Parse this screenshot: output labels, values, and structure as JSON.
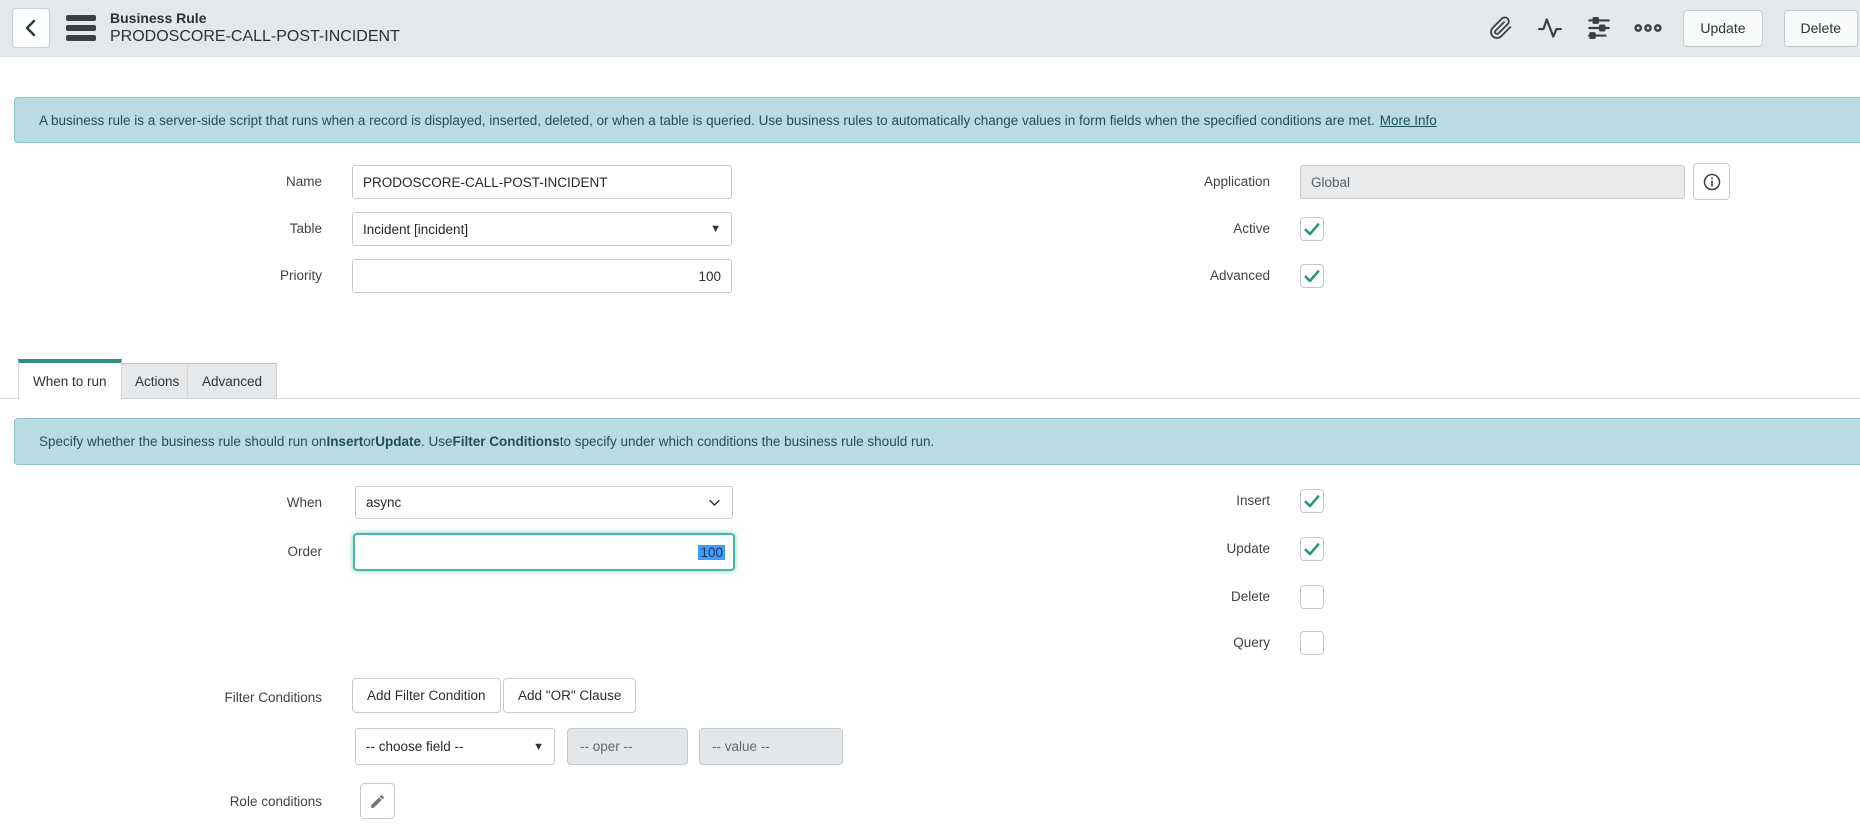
{
  "header": {
    "title": "Business Rule",
    "subtitle": "PRODOSCORE-CALL-POST-INCIDENT",
    "update_label": "Update",
    "delete_label": "Delete"
  },
  "banner_top": {
    "text": "A business rule is a server-side script that runs when a record is displayed, inserted, deleted, or when a table is queried. Use business rules to automatically change values in form fields when the specified conditions are met.",
    "link": "More Info"
  },
  "form": {
    "name": {
      "label": "Name",
      "value": "PRODOSCORE-CALL-POST-INCIDENT"
    },
    "table": {
      "label": "Table",
      "value": "Incident [incident]"
    },
    "priority": {
      "label": "Priority",
      "value": "100"
    },
    "application": {
      "label": "Application",
      "value": "Global"
    },
    "active": {
      "label": "Active",
      "checked": true
    },
    "advanced": {
      "label": "Advanced",
      "checked": true
    }
  },
  "tabs": [
    {
      "label": "When to run",
      "active": true
    },
    {
      "label": "Actions",
      "active": false
    },
    {
      "label": "Advanced",
      "active": false
    }
  ],
  "banner_when": {
    "segments": [
      "Specify whether the business rule should run on ",
      "Insert",
      " or ",
      "Update",
      ". Use ",
      "Filter Conditions",
      " to specify under which conditions the business rule should run."
    ]
  },
  "when_to_run": {
    "when": {
      "label": "When",
      "value": "async"
    },
    "order": {
      "label": "Order",
      "value": "100"
    },
    "checkboxes": [
      {
        "label": "Insert",
        "checked": true
      },
      {
        "label": "Update",
        "checked": true
      },
      {
        "label": "Delete",
        "checked": false
      },
      {
        "label": "Query",
        "checked": false
      }
    ],
    "filter": {
      "label": "Filter Conditions",
      "add_condition_label": "Add Filter Condition",
      "add_or_label": "Add \"OR\" Clause",
      "choose_field": "-- choose field --",
      "oper": "-- oper --",
      "value": "-- value --"
    },
    "role": {
      "label": "Role conditions"
    }
  },
  "colors": {
    "accent_teal": "#2e8d80",
    "focus_teal": "#49b6aa",
    "banner_bg": "#b9dce4",
    "banner_border": "#8fc2cf",
    "banner_text": "#1d4f5a",
    "header_bg": "#e4e8ea",
    "selection_blue": "#3f9ef8",
    "readonly_bg": "#e8eaec"
  }
}
